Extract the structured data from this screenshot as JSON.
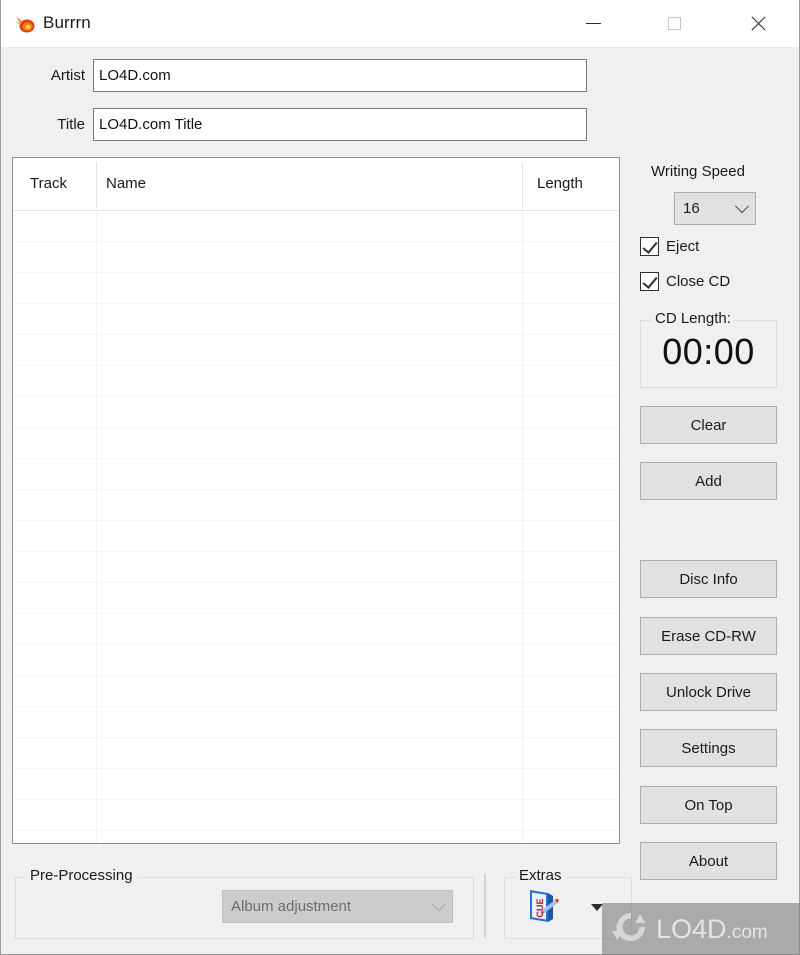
{
  "window": {
    "title": "Burrrn",
    "app_icon": "flame-icon",
    "controls": {
      "minimize": "minimize-icon",
      "maximize": "maximize-icon",
      "close": "close-icon"
    }
  },
  "form": {
    "artist_label": "Artist",
    "artist_value": "LO4D.com",
    "artist_placeholder": "",
    "title_label": "Title",
    "title_value": "LO4D.com Title",
    "title_placeholder": ""
  },
  "tracklist": {
    "columns": [
      "Track",
      "Name",
      "Length"
    ],
    "rows": [],
    "empty_row_count": 20
  },
  "side_panel": {
    "writing_speed_label": "Writing Speed",
    "writing_speed_value": "16",
    "writing_speed_options": [
      "16"
    ],
    "eject_label": "Eject",
    "eject_checked": true,
    "close_cd_label": "Close CD",
    "close_cd_checked": true,
    "cd_length_label": "CD Length:",
    "cd_length_value": "00:00",
    "buttons": [
      {
        "label": "Clear"
      },
      {
        "label": "Add"
      },
      {
        "label": "Disc Info"
      },
      {
        "label": "Erase CD-RW"
      },
      {
        "label": "Unlock Drive"
      },
      {
        "label": "Settings"
      },
      {
        "label": "On Top"
      },
      {
        "label": "About"
      }
    ]
  },
  "bottom": {
    "preprocessing_title": "Pre-Processing",
    "preprocessing_combo_value": "Album adjustment",
    "preprocessing_combo_enabled": false,
    "extras_title": "Extras",
    "extras_icon": "cue-file-icon",
    "extras_dropdown_icon": "caret-down-icon"
  },
  "watermark": {
    "text": "LO4D",
    "suffix": ".com",
    "logo": "refresh-circle-icon"
  },
  "colors": {
    "window_bg": "#f0f0f0",
    "titlebar_bg": "#ffffff",
    "list_bg": "#ffffff",
    "button_bg": "#e1e1e1",
    "button_border": "#adadad",
    "text": "#1a1a1a"
  }
}
